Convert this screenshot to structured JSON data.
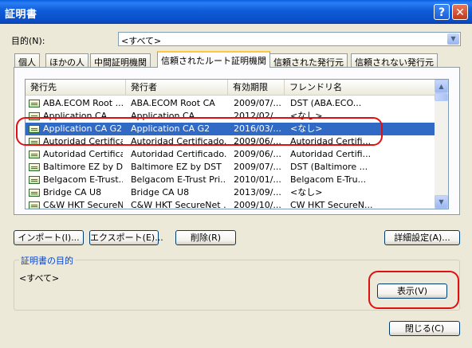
{
  "window": {
    "title": "証明書",
    "help_glyph": "?",
    "close_glyph": "✕"
  },
  "purpose": {
    "label": "目的(N):",
    "value": "<すべて>"
  },
  "tabs": [
    {
      "label": "個人"
    },
    {
      "label": "ほかの人"
    },
    {
      "label": "中間証明機関"
    },
    {
      "label": "信頼されたルート証明機関"
    },
    {
      "label": "信頼された発行元"
    },
    {
      "label": "信頼されない発行元"
    }
  ],
  "list": {
    "headers": [
      "発行先",
      "発行者",
      "有効期限",
      "フレンドリ名"
    ],
    "rows": [
      [
        "ABA.ECOM Root ...",
        "ABA.ECOM Root CA",
        "2009/07/...",
        "DST (ABA.ECO..."
      ],
      [
        "Application CA",
        "Application CA",
        "2012/02/...",
        "<なし>"
      ],
      [
        "Application CA G2",
        "Application CA G2",
        "2016/03/...",
        "<なし>"
      ],
      [
        "Autoridad Certifica...",
        "Autoridad Certificado...",
        "2009/06/...",
        "Autoridad Certifi..."
      ],
      [
        "Autoridad Certifica...",
        "Autoridad Certificado...",
        "2009/06/...",
        "Autoridad Certifi..."
      ],
      [
        "Baltimore EZ by D...",
        "Baltimore EZ by DST",
        "2009/07/...",
        "DST (Baltimore ..."
      ],
      [
        "Belgacom E-Trust...",
        "Belgacom E-Trust Pri...",
        "2010/01/...",
        "Belgacom E-Tru..."
      ],
      [
        "Bridge CA U8",
        "Bridge CA U8",
        "2013/09/...",
        "<なし>"
      ],
      [
        "C&W HKT SecureN...",
        "C&W HKT SecureNet ...",
        "2009/10/...",
        "CW HKT SecureN..."
      ]
    ],
    "selected_index": 2
  },
  "buttons": {
    "import": "インポート(I)...",
    "export": "エクスポート(E)...",
    "remove": "削除(R)",
    "advanced": "詳細設定(A)...",
    "view": "表示(V)",
    "close": "閉じる(C)"
  },
  "cert_purpose": {
    "label": "証明書の目的",
    "value": "<すべて>"
  },
  "colors": {
    "titlebar": "#0a54d6",
    "selection": "#316ac5",
    "annotation": "#e01010",
    "active_tab_accent": "#ffc83c"
  }
}
